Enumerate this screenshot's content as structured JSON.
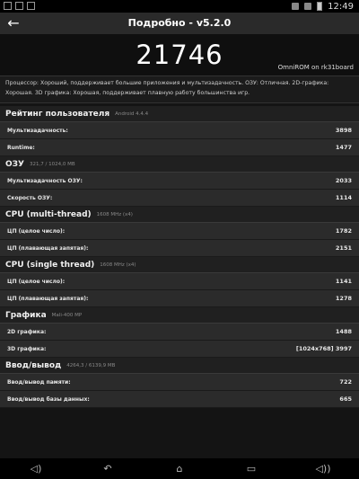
{
  "status_bar": {
    "time": "12:49"
  },
  "toolbar": {
    "title": "Подробно - v5.2.0"
  },
  "score": {
    "total": "21746",
    "device": "OmniROM on rk31board"
  },
  "description": "Процессор: Хороший, поддерживает большие приложения и мультизадачность. ОЗУ: Отличная. 2D-графика: Хорошая. 3D графика: Хорошая, поддерживает плавную работу большинства игр.",
  "sections": [
    {
      "title": "Рейтинг пользователя",
      "subtitle": "Android 4.4.4",
      "rows": [
        {
          "label": "Мультизадачность:",
          "value": "3898"
        },
        {
          "label": "Runtime:",
          "value": "1477"
        }
      ]
    },
    {
      "title": "ОЗУ",
      "subtitle": "321,7 / 1024,0 MB",
      "rows": [
        {
          "label": "Мультизадачность ОЗУ:",
          "value": "2033"
        },
        {
          "label": "Скорость ОЗУ:",
          "value": "1114"
        }
      ]
    },
    {
      "title": "CPU (multi-thread)",
      "subtitle": "1608 MHz (x4)",
      "rows": [
        {
          "label": "ЦП (целое число):",
          "value": "1782"
        },
        {
          "label": "ЦП (плавающая запятая):",
          "value": "2151"
        }
      ]
    },
    {
      "title": "CPU (single thread)",
      "subtitle": "1608 MHz (x4)",
      "rows": [
        {
          "label": "ЦП (целое число):",
          "value": "1141"
        },
        {
          "label": "ЦП (плавающая запятая):",
          "value": "1278"
        }
      ]
    },
    {
      "title": "Графика",
      "subtitle": "Mali-400 MP",
      "rows": [
        {
          "label": "2D графика:",
          "value": "1488"
        },
        {
          "label": "3D графика:",
          "value": "[1024x768] 3997"
        }
      ]
    },
    {
      "title": "Ввод/вывод",
      "subtitle": "4264,3 / 6139,9 MB",
      "rows": [
        {
          "label": "Ввод/вывод памяти:",
          "value": "722"
        },
        {
          "label": "Ввод/вывод базы данных:",
          "value": "665"
        }
      ]
    }
  ],
  "icons": {
    "back": "back-arrow-icon",
    "nav": [
      "volume-down-icon",
      "back-icon",
      "home-icon",
      "recents-icon",
      "volume-up-icon"
    ]
  }
}
